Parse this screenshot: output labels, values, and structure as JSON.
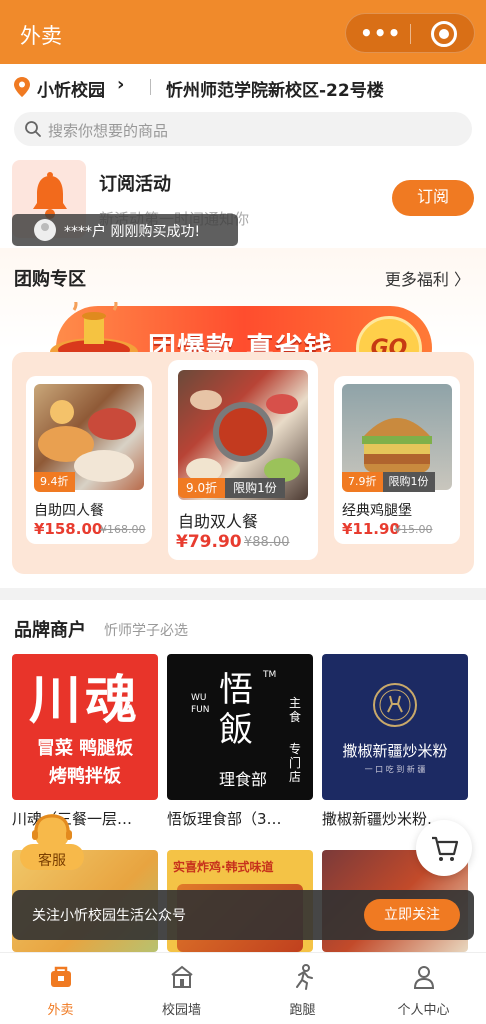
{
  "header": {
    "title": "外卖",
    "more_icon": "more-dots-icon",
    "close_icon": "target-circle-icon"
  },
  "location": {
    "campus": "小忻校园",
    "address": "忻州师范学院新校区-22号楼"
  },
  "search": {
    "placeholder": "搜索你想要的商品"
  },
  "subscribe": {
    "title": "订阅活动",
    "desc": "新活动第一时间通知你",
    "button": "订阅"
  },
  "toast": {
    "text": "****户 刚刚购买成功!"
  },
  "group_buy": {
    "title": "团购专区",
    "more": "更多福利 〉",
    "banner_text": "团爆款 真省钱",
    "banner_go": "GO",
    "items": [
      {
        "name": "自助四人餐",
        "discount": "9.4折",
        "limit": "",
        "price": "¥158.00",
        "orig": "¥168.00"
      },
      {
        "name": "自助双人餐",
        "discount": "9.0折",
        "limit": "限购1份",
        "price": "¥79.90",
        "orig": "¥88.00"
      },
      {
        "name": "经典鸡腿堡",
        "discount": "7.9折",
        "limit": "限购1份",
        "price": "¥11.90",
        "orig": "¥15.00"
      }
    ]
  },
  "brand": {
    "title": "品牌商户",
    "subtitle": "忻师学子必选",
    "items": [
      {
        "name": "川魂（三餐一层…",
        "logo_main": "川魂",
        "logo_line1": "冒菜 鸭腿饭",
        "logo_line2": "烤鸭拌饭"
      },
      {
        "name": "悟饭理食部（3…",
        "logo_main": "悟飯",
        "logo_top": "WU FUN",
        "logo_tm": "TM",
        "logo_bottom": "理食部",
        "logo_side1": "主食",
        "logo_side2": "专门店"
      },
      {
        "name": "撒椒新疆炒米粉…",
        "logo_main": "撒椒新疆炒米粉",
        "logo_small": "一 口 吃 到 新 疆"
      }
    ],
    "row2_banner": "实喜炸鸡·韩式味道"
  },
  "service": {
    "label": "客服"
  },
  "follow_bar": {
    "text": "关注小忻校园生活公众号",
    "button": "立即关注"
  },
  "tabs": [
    {
      "label": "外卖",
      "icon": "takeout-icon",
      "active": true
    },
    {
      "label": "校园墙",
      "icon": "campus-wall-icon",
      "active": false
    },
    {
      "label": "跑腿",
      "icon": "runner-icon",
      "active": false
    },
    {
      "label": "个人中心",
      "icon": "profile-icon",
      "active": false
    }
  ],
  "colors": {
    "brand_orange": "#f08a2b",
    "price_red": "#e83c2f"
  }
}
